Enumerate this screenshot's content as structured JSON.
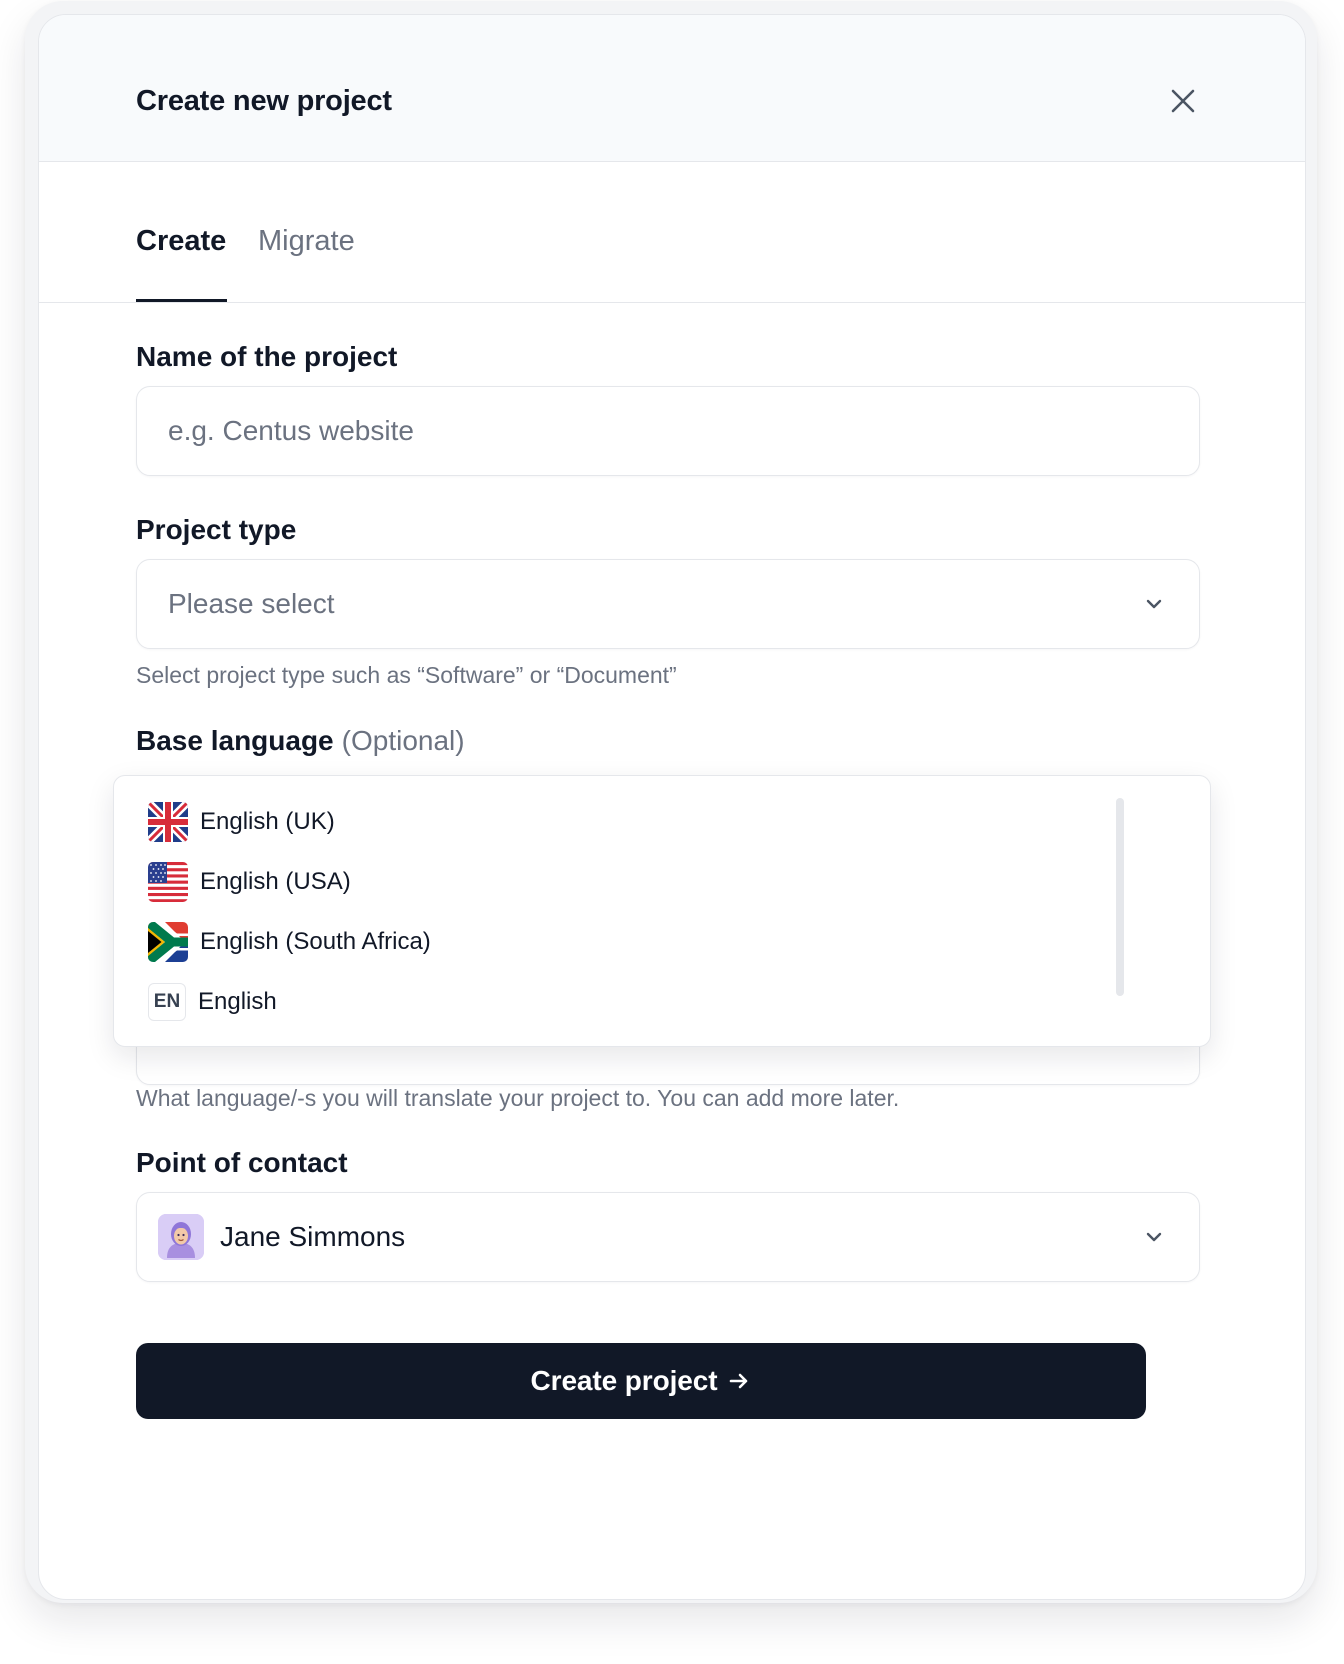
{
  "modal": {
    "title": "Create new project",
    "close_icon": "close-icon"
  },
  "tabs": [
    {
      "label": "Create",
      "active": true
    },
    {
      "label": "Migrate",
      "active": false
    }
  ],
  "form": {
    "name": {
      "label": "Name of the project",
      "placeholder": "e.g. Centus website",
      "value": ""
    },
    "project_type": {
      "label": "Project type",
      "placeholder": "Please select",
      "help": "Select project type such as “Software” or “Document”"
    },
    "base_language": {
      "label": "Base language",
      "optional": "(Optional)",
      "options": [
        {
          "label": "English (UK)",
          "icon": "uk-flag-icon"
        },
        {
          "label": "English (USA)",
          "icon": "usa-flag-icon"
        },
        {
          "label": "English (South Africa)",
          "icon": "south-africa-flag-icon"
        },
        {
          "label": "English",
          "icon": "language-code-icon",
          "code": "EN"
        }
      ]
    },
    "target_languages": {
      "help": "What language/-s you will translate your project to. You can add more later."
    },
    "point_of_contact": {
      "label": "Point of contact",
      "value": "Jane Simmons",
      "avatar_icon": "avatar"
    }
  },
  "submit": {
    "label": "Create project",
    "icon": "arrow-right-icon"
  },
  "colors": {
    "primary": "#111827",
    "muted_text": "#6b7280",
    "border": "#e5e7eb",
    "header_bg": "#f8fafc"
  }
}
